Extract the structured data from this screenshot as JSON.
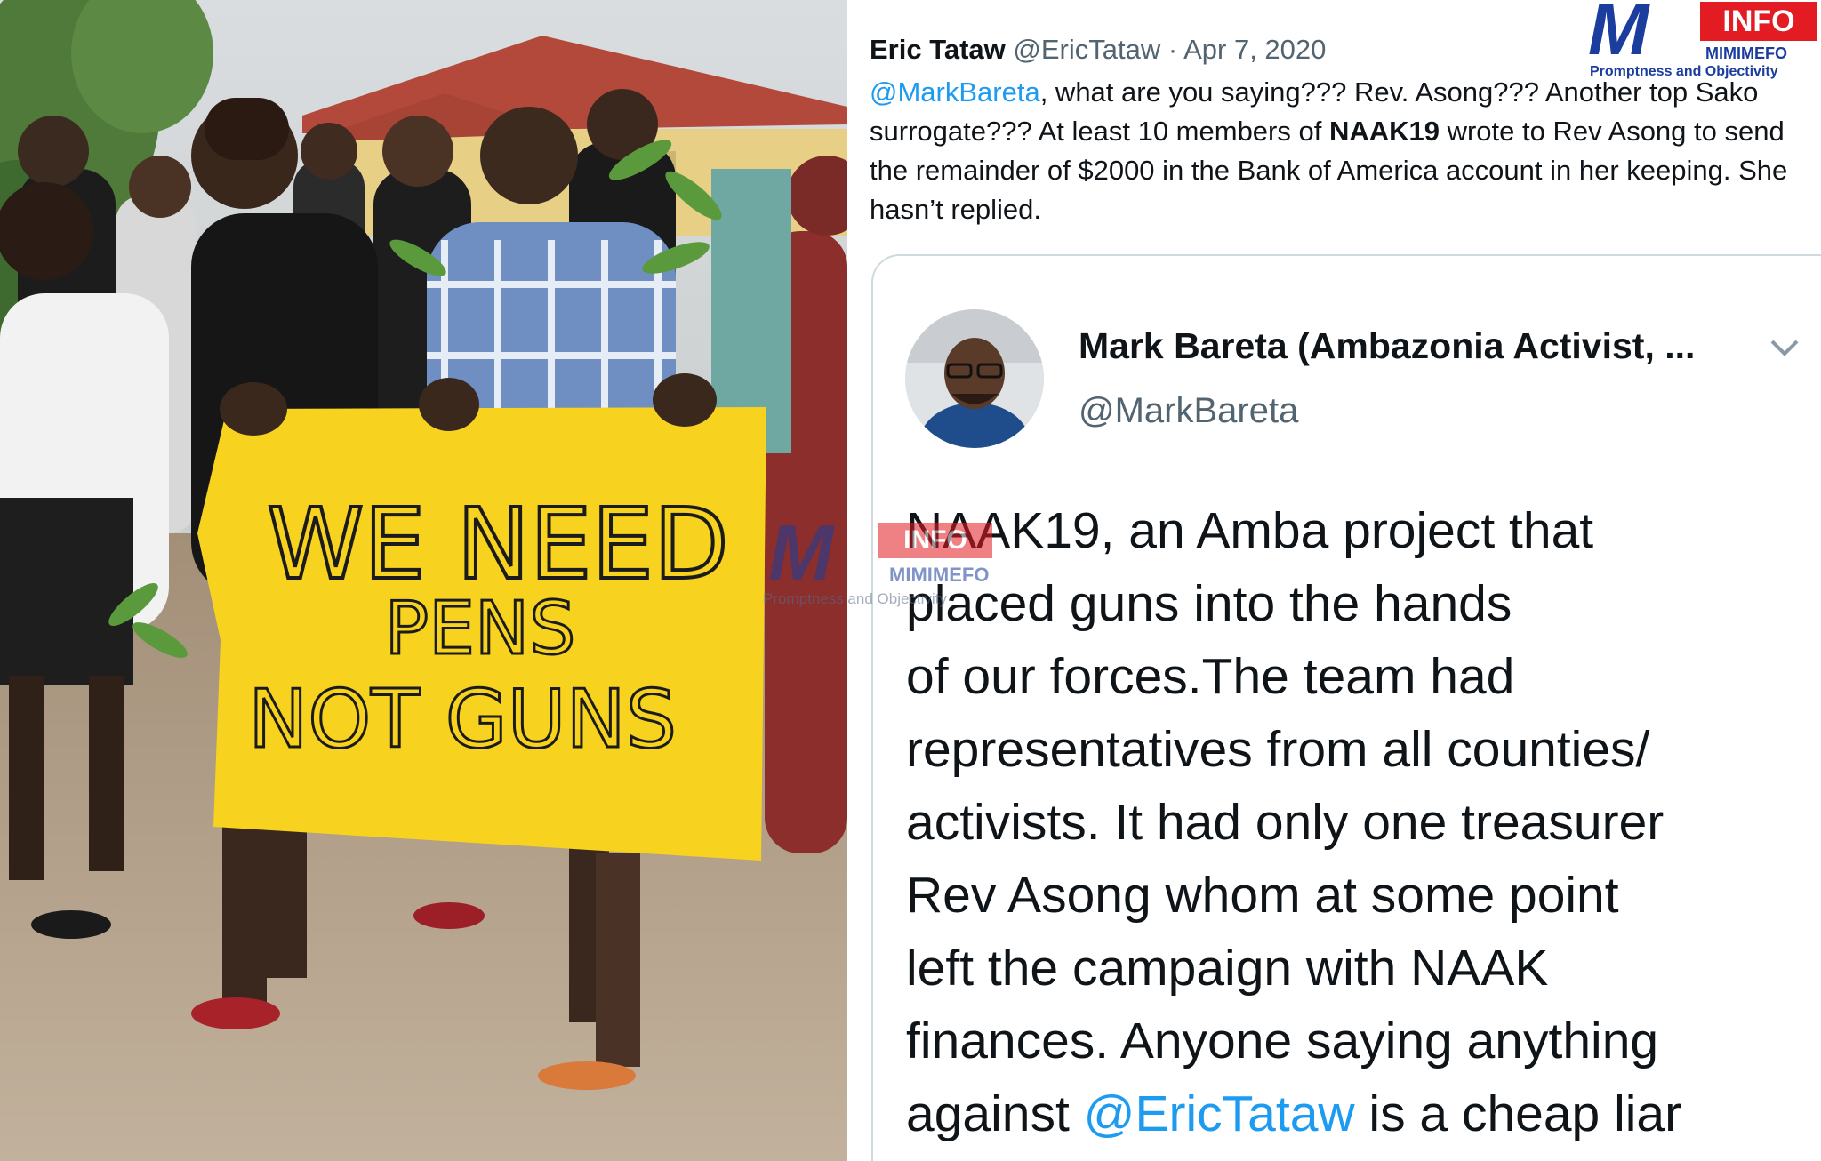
{
  "tweet": {
    "author_name": "Eric Tataw",
    "author_handle": "@EricTataw",
    "date": "Apr 7, 2020",
    "reply_to": "@MarkBareta",
    "text_part1": ", what are you saying??? Rev. Asong??? Another top Sako surrogate??? At least 10 members of ",
    "text_bold": "NAAK19",
    "text_part2": " wrote to Rev Asong to send the remainder of $2000 in the Bank of America account in her keeping. She hasn’t replied."
  },
  "quoted_tweet": {
    "author_name": "Mark Bareta (Ambazonia Activist, ...",
    "author_handle": "@MarkBareta",
    "lines": [
      "NAAK19, an Amba project that",
      "placed guns into the hands",
      "of our forces.The team had",
      "representatives from all counties/",
      "activists. It had only one treasurer",
      "Rev Asong whom at some point",
      "left the campaign with NAAK",
      "finances. Anyone saying anything"
    ],
    "last_line_prefix": "against ",
    "last_line_mention": "@EricTataw",
    "last_line_suffix": " is a cheap liar"
  },
  "photo": {
    "sign_line1": "WE NEED",
    "sign_line2": "PENS",
    "sign_line3": "NOT GUNS"
  },
  "watermark": {
    "badge": "INFO",
    "brand": "MIMIMEFO",
    "tagline": "Promptness and Objectivity"
  },
  "colors": {
    "link": "#1d9bf0",
    "sign": "#f7d21e",
    "logo_blue": "#1b3d9e",
    "logo_red": "#e31b23"
  }
}
